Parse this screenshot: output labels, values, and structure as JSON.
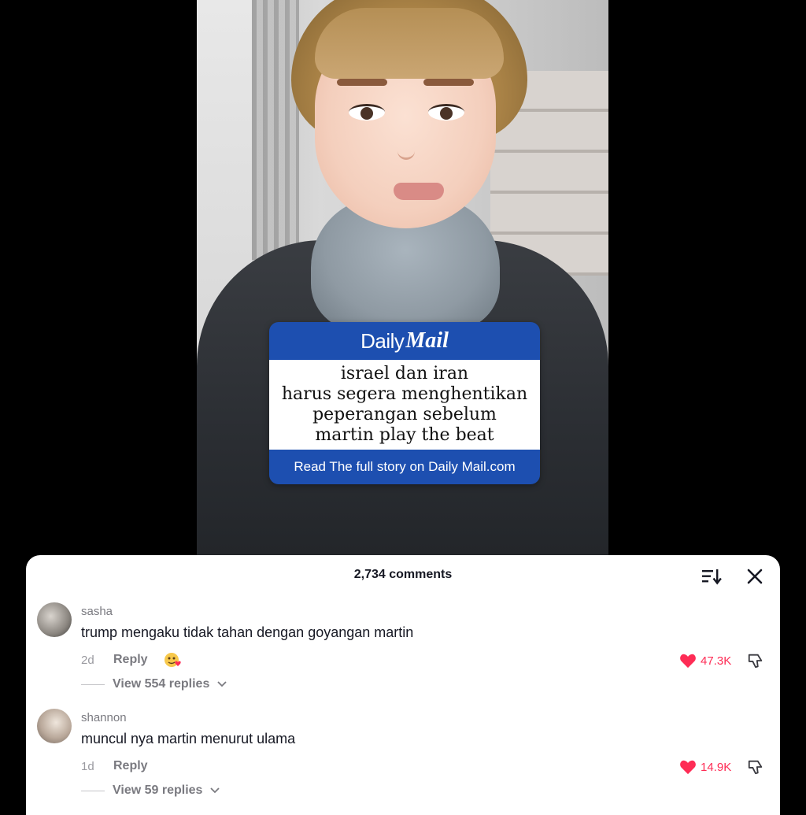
{
  "video": {
    "card": {
      "brand_daily": "Daily",
      "brand_mail": "Mail",
      "headline_lines": [
        "israel dan iran",
        "harus segera menghentikan",
        "peperangan sebelum",
        "martin play the beat"
      ],
      "footer": "Read The full story on Daily Mail.com",
      "color": "#1d4fb0"
    }
  },
  "comments_sheet": {
    "title": "2,734 comments",
    "sort_icon": "sort-icon",
    "close_icon": "close-icon",
    "comments": [
      {
        "username": "sasha",
        "text": "trump mengaku tidak tahan dengan goyangan martin",
        "time": "2d",
        "reply_label": "Reply",
        "likes": "47.3K",
        "view_replies": "View 554 replies"
      },
      {
        "username": "shannon",
        "text": "muncul nya martin menurut ulama",
        "time": "1d",
        "reply_label": "Reply",
        "likes": "14.9K",
        "view_replies": "View 59 replies"
      }
    ]
  },
  "colors": {
    "like": "#fe2c55",
    "text": "#161823",
    "muted": "#7a7a80"
  }
}
